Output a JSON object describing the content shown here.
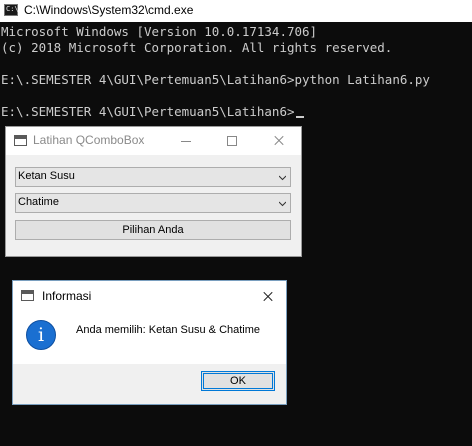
{
  "console": {
    "title": "C:\\Windows\\System32\\cmd.exe",
    "icon": "cmd-icon",
    "prompt_glyph": "C:\\",
    "lines": [
      "Microsoft Windows [Version 10.0.17134.706]",
      "(c) 2018 Microsoft Corporation. All rights reserved.",
      "",
      "E:\\.SEMESTER 4\\GUI\\Pertemuan5\\Latihan6>python Latihan6.py",
      "",
      "E:\\.SEMESTER 4\\GUI\\Pertemuan5\\Latihan6>"
    ],
    "colors": {
      "background": "#0c0c0c",
      "text": "#cccccc"
    }
  },
  "qt_window": {
    "title": "Latihan QComboBox",
    "combo1": {
      "value": "Ketan Susu"
    },
    "combo2": {
      "value": "Chatime"
    },
    "button_label": "Pilihan Anda"
  },
  "message_box": {
    "title": "Informasi",
    "text": "Anda memilih: Ketan Susu & Chatime",
    "icon": "info-icon",
    "icon_glyph": "i",
    "ok_label": "OK",
    "colors": {
      "info_icon": "#1a6fd1",
      "focus_border": "#0078d7"
    }
  }
}
